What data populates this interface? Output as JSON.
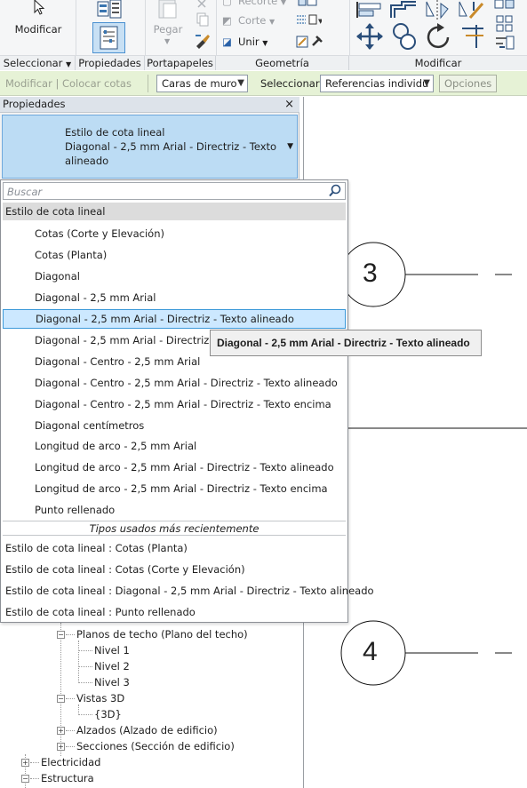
{
  "ribbon": {
    "modify_button_label": "Modificar",
    "paste_label": "Pegar",
    "recorte_label": "Recorte",
    "corte_label": "Corte",
    "unir_label": "Unir",
    "panel_titles": [
      "Seleccionar",
      "Propiedades",
      "Portapapeles",
      "Geometría",
      "Modificar"
    ]
  },
  "options_bar": {
    "modify_context": "Modificar | Colocar cotas",
    "placement_value": "Caras de muro",
    "select_label": "Seleccionar:",
    "select_value": "Referencias individu",
    "options_button": "Opciones"
  },
  "properties": {
    "header": "Propiedades",
    "close": "×",
    "type_line1": "Estilo de cota lineal",
    "type_line2": "Diagonal - 2,5 mm Arial - Directriz - Texto",
    "type_line3": "alineado"
  },
  "dropdown": {
    "search_placeholder": "Buscar",
    "group_header": "Estilo de cota lineal",
    "items": [
      "Cotas (Corte y Elevación)",
      "Cotas (Planta)",
      "Diagonal",
      "Diagonal - 2,5 mm Arial",
      "Diagonal - 2,5 mm Arial - Directriz - Texto alineado",
      "Diagonal - 2,5 mm Arial - Directriz - T",
      "Diagonal - Centro - 2,5 mm Arial",
      "Diagonal - Centro - 2,5 mm Arial - Directriz - Texto alineado",
      "Diagonal - Centro - 2,5 mm Arial - Directriz - Texto encima",
      "Diagonal centímetros",
      "Longitud de arco - 2,5 mm Arial",
      "Longitud de arco - 2,5 mm Arial - Directriz - Texto alineado",
      "Longitud de arco - 2,5 mm Arial - Directriz - Texto encima",
      "Punto rellenado"
    ],
    "recent_header": "Tipos usados más recientemente",
    "recent": [
      "Estilo de cota lineal : Cotas (Planta)",
      "Estilo de cota lineal : Cotas (Corte y Elevación)",
      "Estilo de cota lineal : Diagonal - 2,5 mm Arial - Directriz - Texto alineado",
      "Estilo de cota lineal : Punto rellenado"
    ],
    "tooltip": "Diagonal - 2,5 mm Arial - Directriz - Texto alineado"
  },
  "browser": {
    "planos_techo": "Planos de techo (Plano del techo)",
    "nivel1": "Nivel 1",
    "nivel2": "Nivel 2",
    "nivel3": "Nivel 3",
    "vistas3d": "Vistas 3D",
    "view3d": "{3D}",
    "alzados": "Alzados (Alzado de edificio)",
    "secciones": "Secciones (Sección de edificio)",
    "electricidad": "Electricidad",
    "estructura": "Estructura"
  },
  "canvas": {
    "grid_bubble_3": "3",
    "grid_bubble_4": "4"
  },
  "colors": {
    "options_bar_bg": "#e6f2d6",
    "selection_bg": "#cce8ff",
    "type_selector_bg": "#bcdcf4"
  }
}
